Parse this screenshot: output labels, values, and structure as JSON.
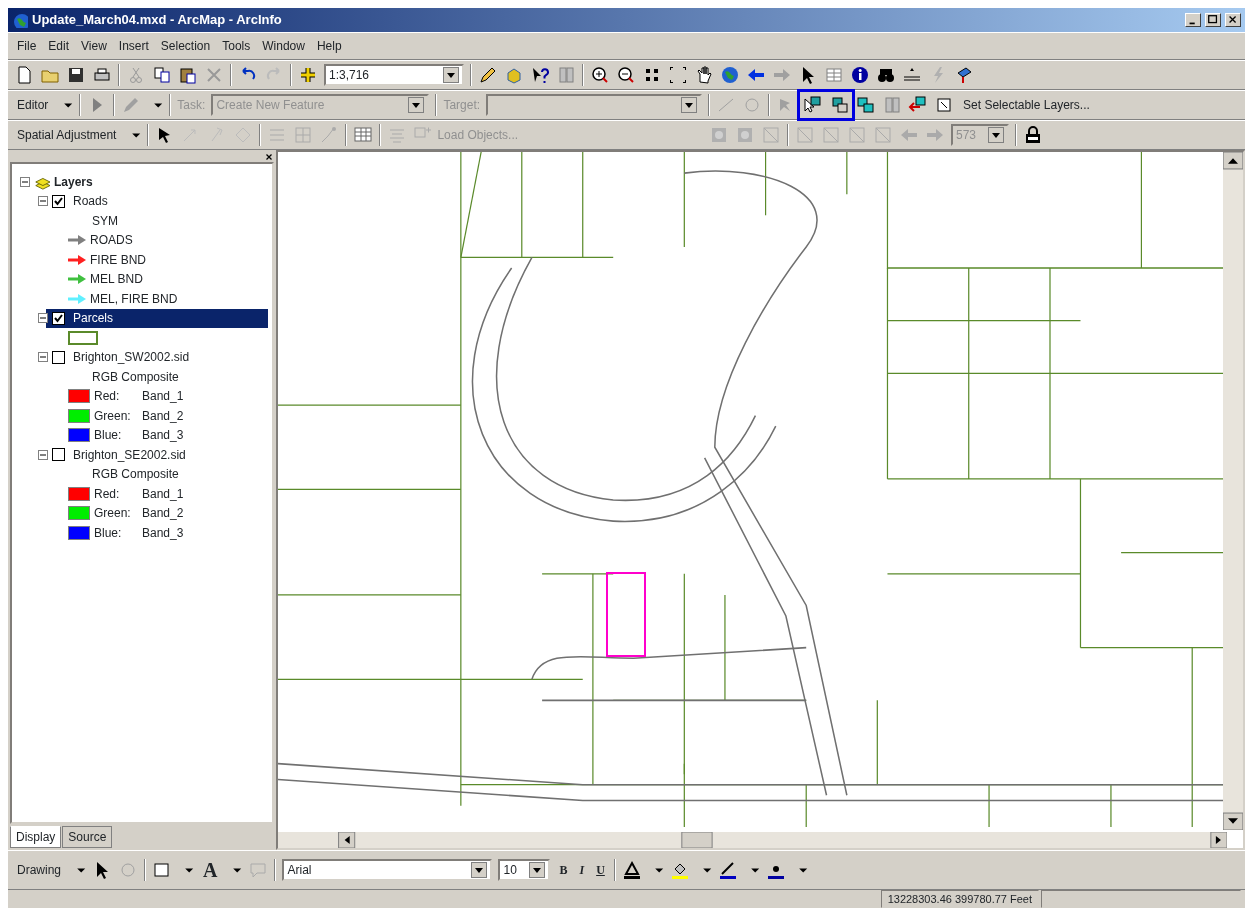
{
  "window": {
    "title": "Update_March04.mxd - ArcMap - ArcInfo"
  },
  "menu": [
    "File",
    "Edit",
    "View",
    "Insert",
    "Selection",
    "Tools",
    "Window",
    "Help"
  ],
  "standard_toolbar": {
    "scale": "1:3,716"
  },
  "editor_toolbar": {
    "editor_menu": "Editor",
    "task_label": "Task:",
    "task": "Create New Feature",
    "target_label": "Target:",
    "set_selectable": "Set Selectable Layers..."
  },
  "spatial_toolbar": {
    "menu": "Spatial Adjustment",
    "load_objects": "Load Objects...",
    "field": "573"
  },
  "toc": {
    "tree": [
      {
        "kind": "group",
        "label": "Layers",
        "expanded": true,
        "children": [
          {
            "kind": "layer",
            "label": "Roads",
            "checked": true,
            "selected": false,
            "expanded": true,
            "children": [
              {
                "kind": "heading",
                "label": "SYM"
              },
              {
                "kind": "arrow",
                "label": "ROADS",
                "color": "#808080"
              },
              {
                "kind": "arrow",
                "label": "FIRE BND",
                "color": "#ff2020"
              },
              {
                "kind": "arrow",
                "label": "MEL BND",
                "color": "#40c040"
              },
              {
                "kind": "arrow",
                "label": "MEL, FIRE BND",
                "color": "#60f0ff"
              }
            ]
          },
          {
            "kind": "layer",
            "label": "Parcels",
            "checked": true,
            "selected": true,
            "expanded": true,
            "children": [
              {
                "kind": "outline",
                "color": "#5a8a2a"
              }
            ]
          },
          {
            "kind": "layer",
            "label": "Brighton_SW2002.sid",
            "checked": false,
            "selected": false,
            "expanded": true,
            "children": [
              {
                "kind": "heading",
                "label": "RGB Composite"
              },
              {
                "kind": "swatch",
                "label": "Red:",
                "value": "Band_1",
                "color": "#ff0000"
              },
              {
                "kind": "swatch",
                "label": "Green:",
                "value": "Band_2",
                "color": "#00ee00"
              },
              {
                "kind": "swatch",
                "label": "Blue:",
                "value": "Band_3",
                "color": "#0000ff"
              }
            ]
          },
          {
            "kind": "layer",
            "label": "Brighton_SE2002.sid",
            "checked": false,
            "selected": false,
            "expanded": true,
            "children": [
              {
                "kind": "heading",
                "label": "RGB Composite"
              },
              {
                "kind": "swatch",
                "label": "Red:",
                "value": "Band_1",
                "color": "#ff0000"
              },
              {
                "kind": "swatch",
                "label": "Green:",
                "value": "Band_2",
                "color": "#00ee00"
              },
              {
                "kind": "swatch",
                "label": "Blue:",
                "value": "Band_3",
                "color": "#0000ff"
              }
            ]
          }
        ]
      }
    ]
  },
  "toc_tabs": [
    {
      "label": "Display",
      "selected": true
    },
    {
      "label": "Source",
      "selected": false
    }
  ],
  "drawing_toolbar": {
    "menu": "Drawing",
    "text_tool": "A",
    "font": "Arial",
    "size": "10",
    "bold": "B",
    "italic": "I",
    "underline": "U"
  },
  "status_bar": {
    "coordinates": "13228303.46  399780.77 Feet"
  }
}
